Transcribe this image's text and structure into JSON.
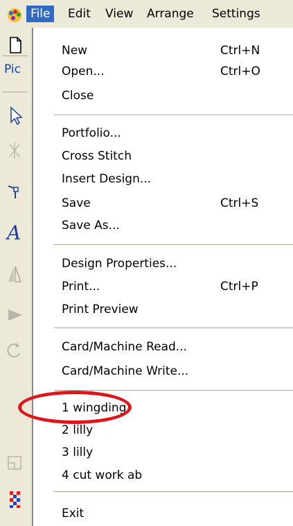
{
  "menubar": {
    "items": [
      "File",
      "Edit",
      "View",
      "Arrange",
      "Settings"
    ]
  },
  "toolbar": {
    "pick_label": "Pic"
  },
  "file_menu": {
    "items": [
      {
        "label": "New",
        "shortcut": "Ctrl+N"
      },
      {
        "label": "Open...",
        "shortcut": "Ctrl+O"
      },
      {
        "label": "Close",
        "shortcut": ""
      },
      {
        "label": "Portfolio...",
        "shortcut": ""
      },
      {
        "label": "Cross Stitch",
        "shortcut": ""
      },
      {
        "label": "Insert Design...",
        "shortcut": ""
      },
      {
        "label": "Save",
        "shortcut": "Ctrl+S"
      },
      {
        "label": "Save As...",
        "shortcut": ""
      },
      {
        "label": "Design Properties...",
        "shortcut": ""
      },
      {
        "label": "Print...",
        "shortcut": "Ctrl+P"
      },
      {
        "label": "Print Preview",
        "shortcut": ""
      },
      {
        "label": "Card/Machine Read...",
        "shortcut": ""
      },
      {
        "label": "Card/Machine Write...",
        "shortcut": ""
      },
      {
        "label": "1 wingding",
        "shortcut": ""
      },
      {
        "label": "2 lilly",
        "shortcut": ""
      },
      {
        "label": "3 lilly",
        "shortcut": ""
      },
      {
        "label": "4 cut work ab",
        "shortcut": ""
      },
      {
        "label": "Exit",
        "shortcut": ""
      }
    ]
  },
  "colors": {
    "menu_highlight": "#316ac5",
    "annotation": "#e0151b"
  }
}
